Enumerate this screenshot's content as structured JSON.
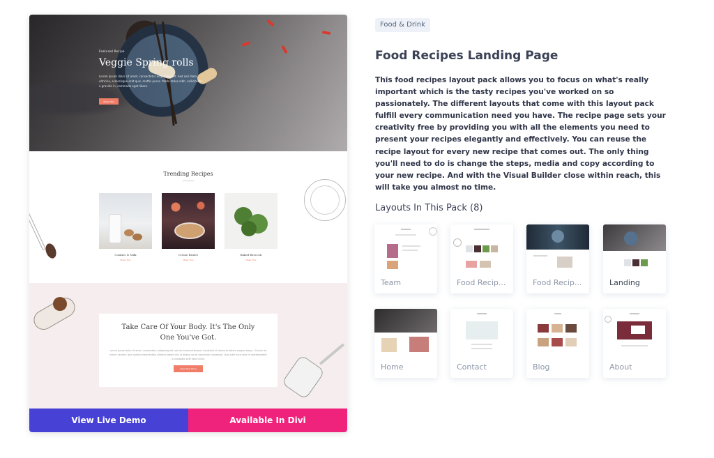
{
  "preview": {
    "hero": {
      "eyebrow": "Featured Recipe",
      "title": "Veggie Spring rolls",
      "body": "Lorem ipsum dolor sit amet, consectetur adipiscing elit. Sed sed diam ultricies, scelerisque erat quis, mattis purus. Morbi tellus nibh, sollicitudin a gravida in, commodo eget libero.",
      "button": "Make This"
    },
    "trending": {
      "title": "Trending Recipes",
      "recipes": [
        {
          "name": "Cookies & Milk",
          "link": "Make This"
        },
        {
          "name": "Creme Brulee",
          "link": "Make This"
        },
        {
          "name": "Baked Broccoli",
          "link": "Make This"
        }
      ]
    },
    "care": {
      "title": "Take Care Of Your Body. It's The Only One You've Got.",
      "body": "Lorem ipsum dolor sit amet, consectetur adipiscing elit, sed do eiusmod tempor incididunt ut labore et dolore magna aliqua. Ut enim ad minim veniam, quis nostrud exercitation ullamco laboris nisi ut aliquip ex ea commodo consequat. Duis aute irure dolor in reprehenderit in voluptate velit esse cillum.",
      "button": "View Meal Plans"
    },
    "view_demo_label": "View Live Demo",
    "available_label": "Available In Divi"
  },
  "category": "Food & Drink",
  "title": "Food Recipes Landing Page",
  "description": "This food recipes layout pack allows you to focus on what's really important which is the tasty recipes you've worked on so passionately. The different layouts that come with this layout pack fulfill every communication need you have. The recipe page sets your creativity free by providing you with all the elements you need to present your recipes elegantly and effectively. You can reuse the recipe layout for every new recipe that comes out. The only thing you'll need to do is change the steps, media and copy according to your new recipe. And with the Visual Builder close within reach, this will take you almost no time.",
  "layouts_heading": "Layouts In This Pack (8)",
  "layouts": [
    {
      "label": "Team"
    },
    {
      "label": "Food Recip..."
    },
    {
      "label": "Food Recip..."
    },
    {
      "label": "Landing"
    },
    {
      "label": "Home"
    },
    {
      "label": "Contact"
    },
    {
      "label": "Blog"
    },
    {
      "label": "About"
    }
  ],
  "colors": {
    "view_demo": "#4741d6",
    "available": "#f0237c",
    "accent_coral": "#f07d68",
    "badge_bg": "#eef2f8"
  }
}
